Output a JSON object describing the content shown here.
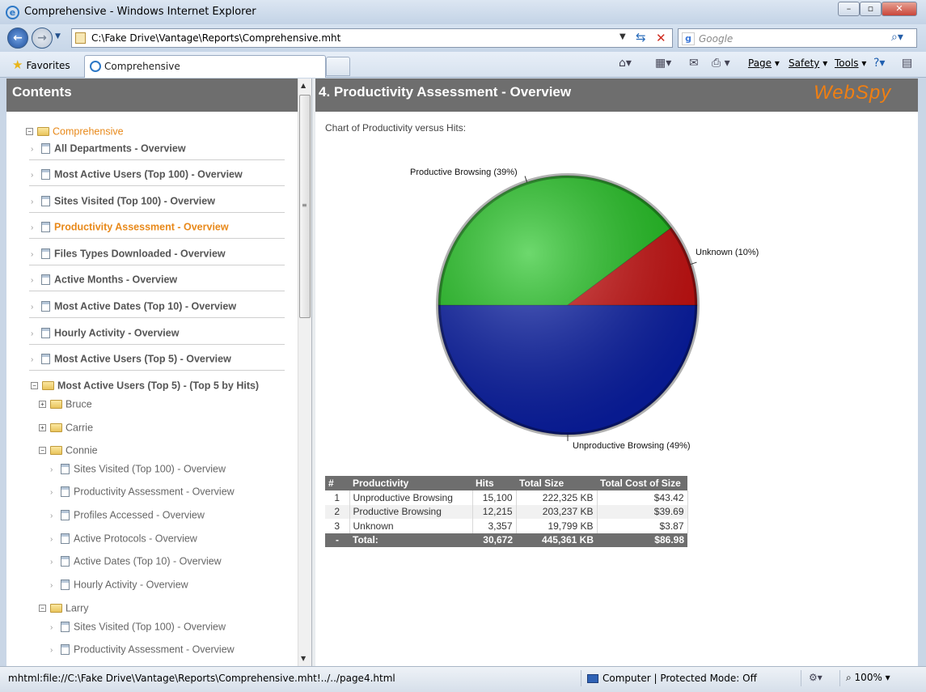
{
  "window": {
    "title": "Comprehensive - Windows Internet Explorer",
    "min": "–",
    "max": "▫",
    "close": "✕"
  },
  "nav": {
    "back": "←",
    "forward": "→",
    "dropdown": "▼",
    "url": "C:\\Fake Drive\\Vantage\\Reports\\Comprehensive.mht",
    "search_placeholder": "Google"
  },
  "cmdbar": {
    "favorites": "Favorites",
    "tab": "Comprehensive",
    "page": "Page",
    "safety": "Safety",
    "tools": "Tools"
  },
  "left": {
    "header": "Contents",
    "tree": [
      {
        "label": "Comprehensive",
        "kind": "root"
      },
      {
        "label": "All Departments - Overview",
        "kind": "report"
      },
      {
        "label": "Most Active Users (Top 100) - Overview",
        "kind": "report"
      },
      {
        "label": "Sites Visited (Top 100) - Overview",
        "kind": "report"
      },
      {
        "label": "Productivity Assessment - Overview",
        "kind": "report-active"
      },
      {
        "label": "Files Types Downloaded - Overview",
        "kind": "report"
      },
      {
        "label": "Active Months - Overview",
        "kind": "report"
      },
      {
        "label": "Most Active Dates (Top 10) - Overview",
        "kind": "report"
      },
      {
        "label": "Hourly Activity - Overview",
        "kind": "report"
      },
      {
        "label": "Most Active Users (Top 5) - Overview",
        "kind": "report"
      },
      {
        "label": "Most Active Users (Top 5) - (Top 5 by Hits)",
        "kind": "folder-open"
      },
      {
        "label": "Bruce",
        "kind": "user-collapsed"
      },
      {
        "label": "Carrie",
        "kind": "user-collapsed"
      },
      {
        "label": "Connie",
        "kind": "user-open"
      },
      {
        "label": "Sites Visited (Top 100) - Overview",
        "kind": "sub"
      },
      {
        "label": "Productivity Assessment - Overview",
        "kind": "sub"
      },
      {
        "label": "Profiles Accessed - Overview",
        "kind": "sub"
      },
      {
        "label": "Active Protocols - Overview",
        "kind": "sub"
      },
      {
        "label": "Active Dates (Top 10) - Overview",
        "kind": "sub"
      },
      {
        "label": "Hourly Activity - Overview",
        "kind": "sub"
      },
      {
        "label": "Larry",
        "kind": "user-open"
      },
      {
        "label": "Sites Visited (Top 100) - Overview",
        "kind": "sub"
      },
      {
        "label": "Productivity Assessment - Overview",
        "kind": "sub"
      }
    ]
  },
  "main": {
    "title": "4. Productivity Assessment - Overview",
    "logo": "WebSpy",
    "caption": "Chart of Productivity versus Hits:"
  },
  "chart_data": {
    "type": "pie",
    "slices": [
      {
        "label": "Unproductive Browsing (49%)",
        "value": 49,
        "color": "#0a1fa8"
      },
      {
        "label": "Productive Browsing (39%)",
        "value": 39,
        "color": "#1fc41f"
      },
      {
        "label": "Unknown (10%)",
        "value": 10,
        "color": "#cc1010"
      }
    ]
  },
  "table": {
    "headers": [
      "#",
      "Productivity",
      "Hits",
      "Total Size",
      "Total Cost of Size"
    ],
    "rows": [
      [
        "1",
        "Unproductive Browsing",
        "15,100",
        "222,325 KB",
        "$43.42"
      ],
      [
        "2",
        "Productive Browsing",
        "12,215",
        "203,237 KB",
        "$39.69"
      ],
      [
        "3",
        "Unknown",
        "3,357",
        "19,799 KB",
        "$3.87"
      ]
    ],
    "total": [
      "-",
      "Total:",
      "30,672",
      "445,361 KB",
      "$86.98"
    ]
  },
  "status": {
    "url": "mhtml:file://C:\\Fake Drive\\Vantage\\Reports\\Comprehensive.mht!../../page4.html",
    "zone": "Computer | Protected Mode: Off",
    "zoom": "100%"
  }
}
